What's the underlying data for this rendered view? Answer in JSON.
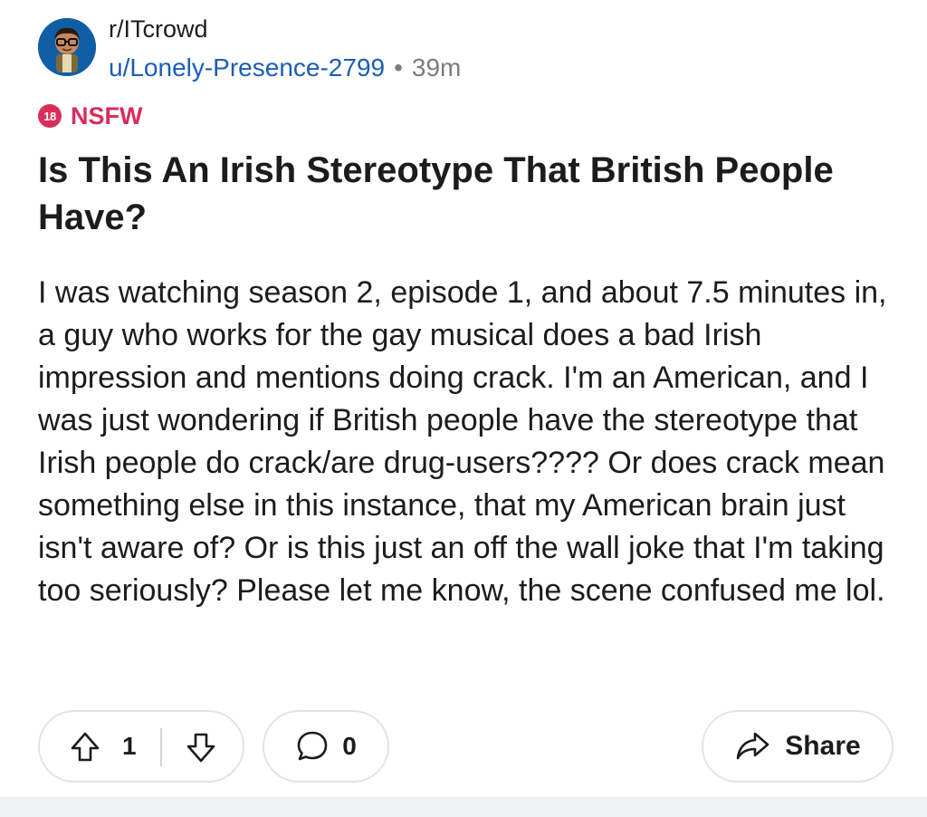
{
  "post": {
    "subreddit": "r/ITcrowd",
    "author": "u/Lonely-Presence-2799",
    "separator": "•",
    "time": "39m",
    "nsfw_badge": "18",
    "nsfw_label": "NSFW",
    "title": "Is This An Irish Stereotype That British People Have?",
    "body": "I was watching season 2, episode 1, and about 7.5 minutes in, a guy who works for the gay musical does a bad Irish impression and mentions doing crack. I'm an American, and I was just wondering if British people have the stereotype that Irish people do crack/are drug-users???? Or does crack mean something else in this instance, that my American brain just isn't aware of? Or is this just an off the wall joke that I'm taking too seriously? Please let me know, the scene confused me lol."
  },
  "actions": {
    "upvote_icon": "upvote-arrow-icon",
    "vote_count": "1",
    "downvote_icon": "downvote-arrow-icon",
    "comment_icon": "comment-bubble-icon",
    "comment_count": "0",
    "share_icon": "share-arrow-icon",
    "share_label": "Share"
  },
  "colors": {
    "nsfw": "#d92d5b",
    "author_link": "#1b5db8",
    "muted": "#7c7c7c",
    "text": "#1c1c1c",
    "pill_border": "#e3e3e3"
  }
}
